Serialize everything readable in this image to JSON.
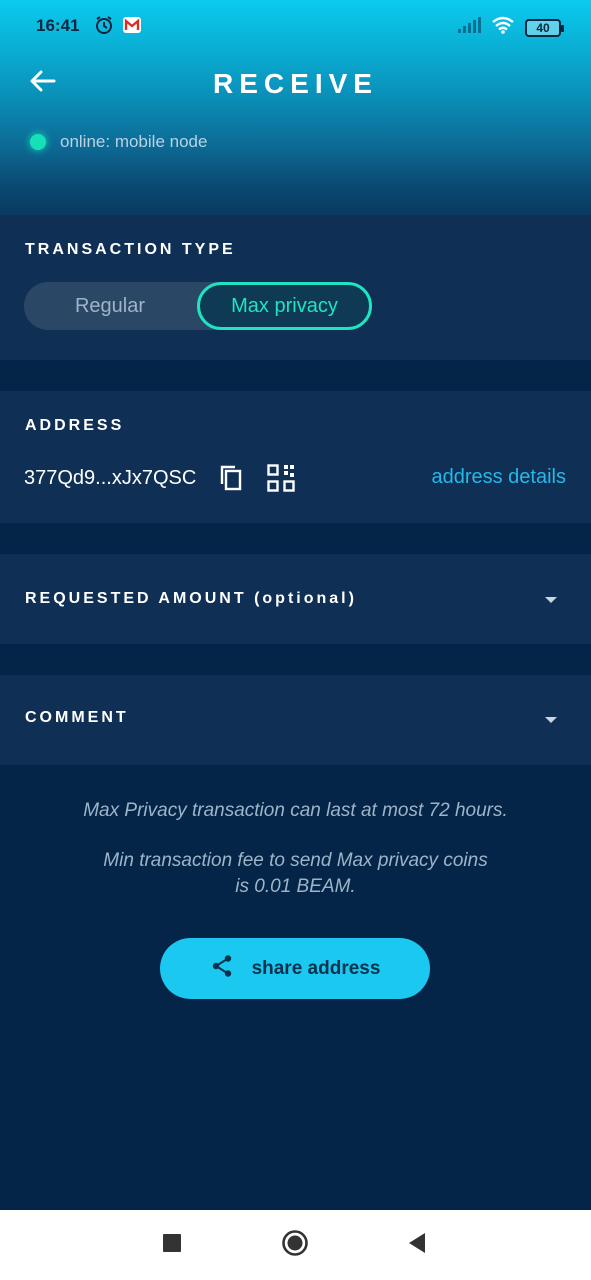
{
  "status_bar": {
    "time": "16:41",
    "battery": "40"
  },
  "header": {
    "title": "RECEIVE",
    "node_status": "online: mobile node"
  },
  "transaction_type": {
    "label": "TRANSACTION TYPE",
    "options": [
      "Regular",
      "Max privacy"
    ],
    "selected": "Max privacy"
  },
  "address": {
    "label": "ADDRESS",
    "value": "377Qd9...xJx7QSC",
    "details_link": "address details"
  },
  "requested_amount": {
    "label": "REQUESTED AMOUNT (optional)"
  },
  "comment": {
    "label": "COMMENT"
  },
  "info": {
    "line1": "Max Privacy transaction can last at most 72 hours.",
    "line2a": "Min transaction fee to send Max privacy coins",
    "line2b": "is 0.01 BEAM."
  },
  "share_button": {
    "label": "share address"
  },
  "colors": {
    "background": "#042548",
    "section": "#0f3054",
    "accent_teal": "#1fe3c1",
    "accent_blue": "#1ac8f0",
    "link": "#24b9e9"
  },
  "icons": {
    "back": "arrow-left-icon",
    "copy": "copy-icon",
    "qr": "qr-code-icon",
    "share": "share-icon",
    "chevron": "chevron-down-icon"
  }
}
